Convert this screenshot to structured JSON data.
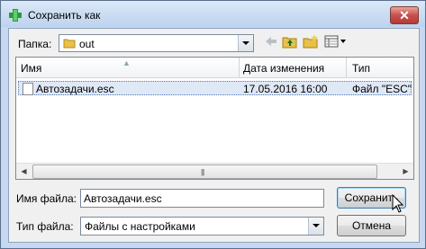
{
  "window": {
    "title": "Сохранить как",
    "close_glyph": "✕"
  },
  "toolbar": {
    "folder_label": "Папка:",
    "folder_value": "out",
    "icons": [
      "back-arrow-icon",
      "up-folder-icon",
      "new-folder-icon",
      "view-menu-icon"
    ]
  },
  "file_list": {
    "columns": [
      "Имя",
      "Дата изменения",
      "Тип"
    ],
    "rows": [
      {
        "name": "Автозадачи.esc",
        "date": "17.05.2016 16:00",
        "type": "Файл \"ESC\""
      }
    ]
  },
  "form": {
    "filename_label": "Имя файла:",
    "filename_value": "Автозадачи.esc",
    "filetype_label": "Тип файла:",
    "filetype_value": "Файлы с настройками"
  },
  "buttons": {
    "save": "Сохранить",
    "cancel": "Отмена"
  },
  "colors": {
    "accent": "#3c7fb1",
    "selection": "#dfe8f5",
    "title_bar": "#c6d9f1"
  }
}
